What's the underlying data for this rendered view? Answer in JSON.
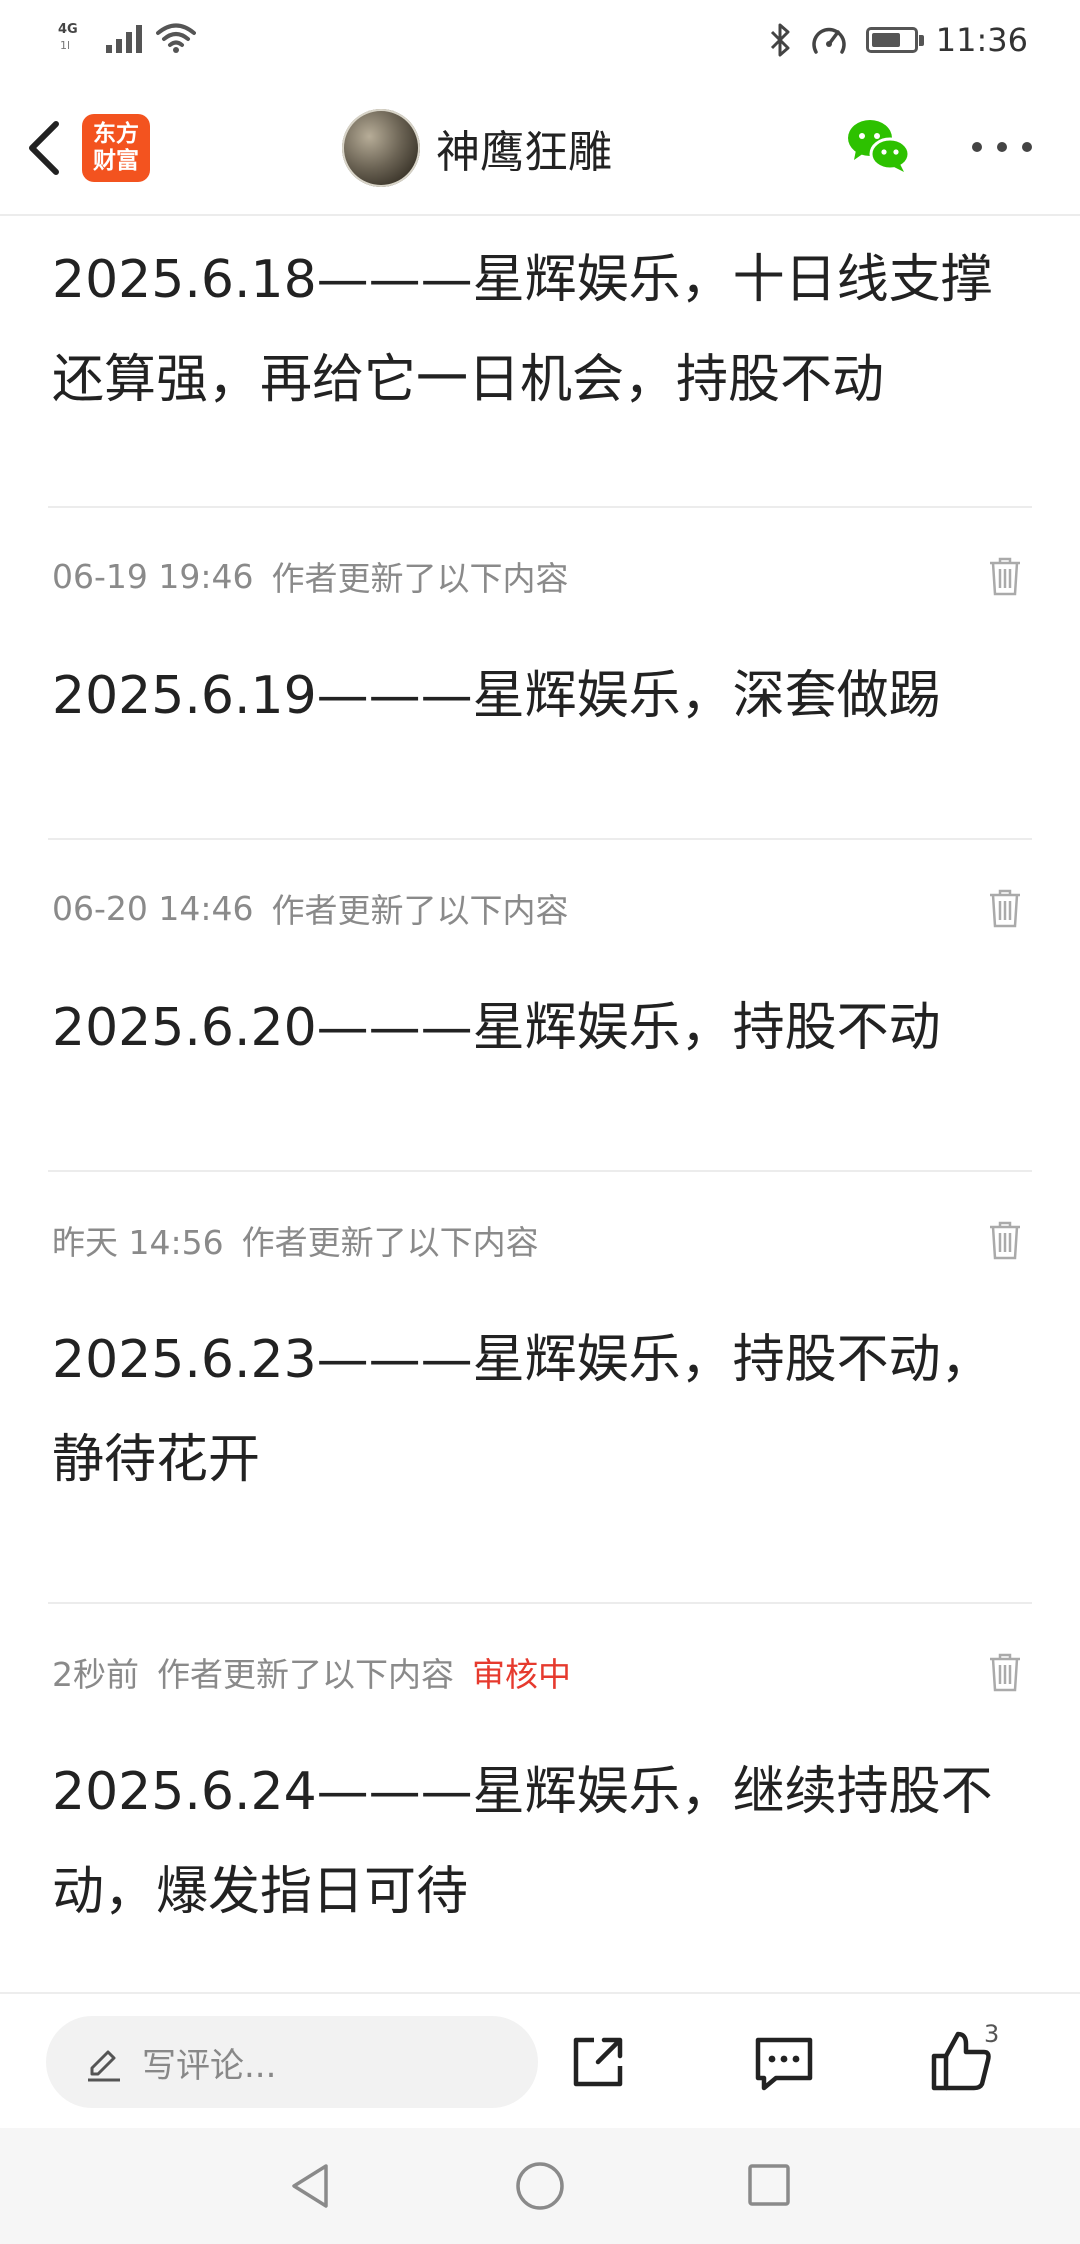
{
  "status_bar": {
    "network_type": "4G",
    "network_sub": "1l",
    "time": "11:36",
    "battery_level": 0.7
  },
  "header": {
    "app_logo_line1": "东方",
    "app_logo_line2": "财富",
    "author_name": "神鹰狂雕",
    "accent_color": "#f3531f"
  },
  "post": {
    "first_entry": "2025.6.18———星辉娱乐，十日线支撑还算强，再给它一日机会，持股不动",
    "updates": [
      {
        "time": "06-19 19:46",
        "label": "作者更新了以下内容",
        "status": "",
        "text": "2025.6.19———星辉娱乐，深套做踢"
      },
      {
        "time": "06-20 14:46",
        "label": "作者更新了以下内容",
        "status": "",
        "text": "2025.6.20———星辉娱乐，持股不动"
      },
      {
        "time": "昨天 14:56",
        "label": "作者更新了以下内容",
        "status": "",
        "text": "2025.6.23———星辉娱乐，持股不动，静待花开"
      },
      {
        "time": "2秒前",
        "label": "作者更新了以下内容",
        "status": "审核中",
        "text": "2025.6.24———星辉娱乐，继续持股不动，爆发指日可待"
      }
    ]
  },
  "action_bar": {
    "comment_placeholder": "写评论...",
    "like_count": "3"
  },
  "icons": {
    "back": "chevron-left-icon",
    "wechat": "wechat-icon",
    "more": "more-dots-icon",
    "trash": "trash-icon",
    "pencil": "pencil-icon",
    "share": "share-icon",
    "message": "message-icon",
    "like": "thumbs-up-icon"
  },
  "colors": {
    "status_red": "#e63a2e",
    "wechat_green": "#2dc100"
  }
}
